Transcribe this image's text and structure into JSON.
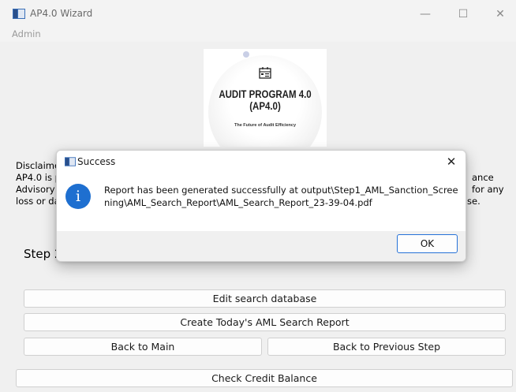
{
  "window": {
    "title": "AP4.0 Wizard",
    "controls": {
      "minimize": "—",
      "maximize": "☐",
      "close": "✕"
    }
  },
  "menu": {
    "items": [
      "Admin"
    ]
  },
  "logo": {
    "title": "AUDIT PROGRAM 4.0 (AP4.0)",
    "tagline": "The Future of Audit Efficiency"
  },
  "background_text": {
    "line1_left": "Disclaime",
    "line2_left": "AP4.0 is p",
    "line2_right": "ance",
    "line3_left": "Advisory",
    "line3_right": "for any",
    "line4_left": "loss or da",
    "line4_right": "se.",
    "step_label": "Step 2"
  },
  "buttons": {
    "edit_search_database": "Edit search database",
    "create_report": "Create Today's AML Search Report",
    "back_to_main": "Back to Main",
    "back_to_previous": "Back to Previous Step",
    "check_credit_balance": "Check Credit Balance"
  },
  "dialog": {
    "title": "Success",
    "close": "✕",
    "message": "Report has been generated successfully at output\\Step1_AML_Sanction_Screening\\AML_Search_Report\\AML_Search_Report_23-39-04.pdf",
    "ok": "OK",
    "icon": "info-icon"
  }
}
